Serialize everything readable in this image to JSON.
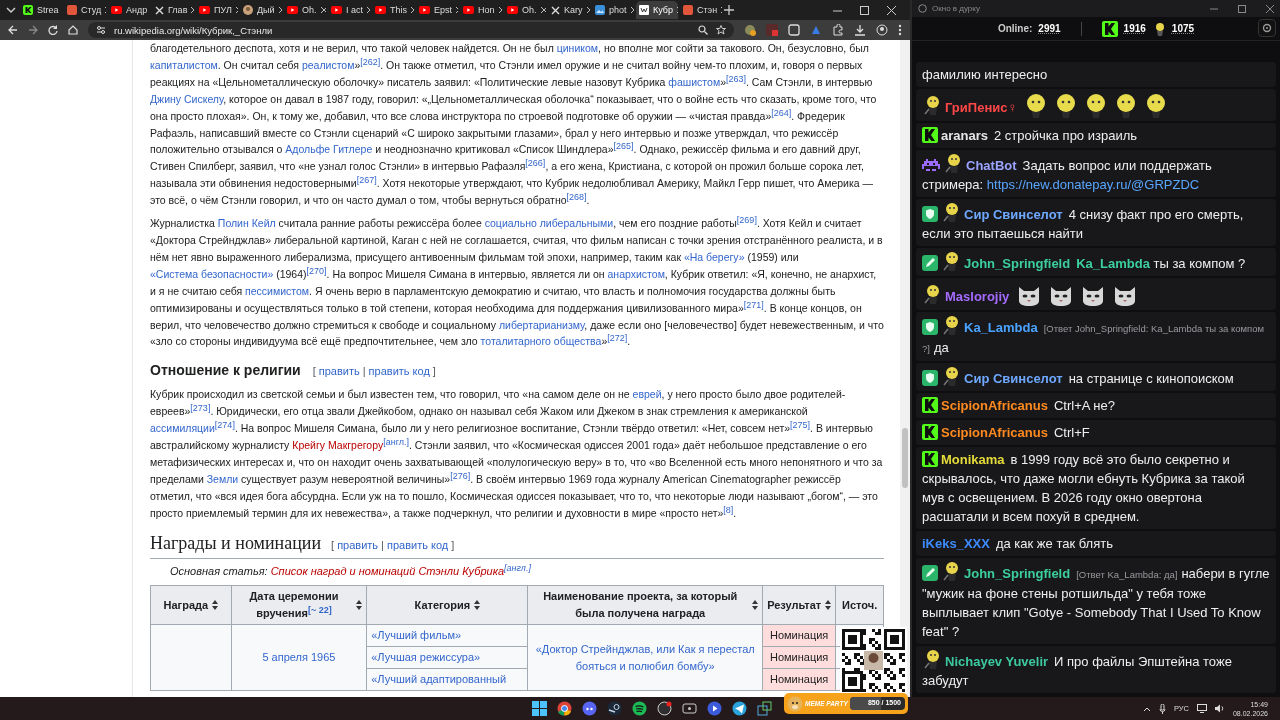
{
  "browser": {
    "tabs": [
      {
        "title": "Strea",
        "kind": "kick",
        "selected": false
      },
      {
        "title": "Студ",
        "kind": "site",
        "selected": false
      },
      {
        "title": "Андр",
        "kind": "youtube",
        "selected": false
      },
      {
        "title": "Глав",
        "kind": "x",
        "selected": false
      },
      {
        "title": "ПУЛ",
        "kind": "youtube",
        "selected": false
      },
      {
        "title": "Дый",
        "kind": "face",
        "selected": false
      },
      {
        "title": "Oh.",
        "kind": "youtube",
        "selected": false
      },
      {
        "title": "I act",
        "kind": "youtube",
        "selected": false
      },
      {
        "title": "This",
        "kind": "youtube",
        "selected": false
      },
      {
        "title": "Epst",
        "kind": "youtube",
        "selected": false
      },
      {
        "title": "Hon",
        "kind": "youtube",
        "selected": false
      },
      {
        "title": "Oh.",
        "kind": "youtube",
        "selected": false
      },
      {
        "title": "Kary",
        "kind": "x",
        "selected": false
      },
      {
        "title": "phot",
        "kind": "image",
        "selected": false
      },
      {
        "title": "Кубр",
        "kind": "wiki",
        "selected": true
      },
      {
        "title": "Стэн",
        "kind": "site",
        "selected": false
      }
    ],
    "address": "ru.wikipedia.org/wiki/Кубрик,_Стэнли"
  },
  "article": {
    "edit_brackets": {
      "open": "[",
      "separator": "|",
      "close": "]"
    },
    "blocks": [
      {
        "kind": "paragraph",
        "segments": [
          {
            "kind": "plain",
            "text": "благодетельного деспота, хотя и не верил, что такой человек найдется. Он не был "
          },
          {
            "kind": "link",
            "text": "циником"
          },
          {
            "kind": "plain",
            "text": ", но вполне мог сойти за такового. Он, безусловно, был "
          },
          {
            "kind": "link",
            "text": "капиталистом"
          },
          {
            "kind": "plain",
            "text": ". Он считал себя "
          },
          {
            "kind": "link",
            "text": "реалистом"
          },
          {
            "kind": "plain",
            "text": "»"
          },
          {
            "kind": "ref",
            "text": "[262]"
          },
          {
            "kind": "plain",
            "text": ". Он также отметил, что Стэнли имел оружие и не считал войну чем-то плохим, и, говоря о первых реакциях на «Цельнометаллическую оболочку» писатель заявил: «Политические левые назовут Кубрика "
          },
          {
            "kind": "link",
            "text": "фашистом"
          },
          {
            "kind": "plain",
            "text": "»"
          },
          {
            "kind": "ref",
            "text": "[263]"
          },
          {
            "kind": "plain",
            "text": ". Сам Стэнли, в интервью "
          },
          {
            "kind": "link",
            "text": "Джину Сискелу"
          },
          {
            "kind": "plain",
            "text": ", которое он давал в 1987 году, говорил: «„Цельнометаллическая оболочка“ показывает, что о войне есть что сказать, кроме того, что она просто плохая». Он, к тому же, добавил, что все слова инструктора по строевой подготовке об оружии — «чистая правда»"
          },
          {
            "kind": "ref",
            "text": "[264]"
          },
          {
            "kind": "plain",
            "text": ". Фредерик Рафаэль, написавший вместе со Стэнли сценарий «С широко закрытыми глазами», брал у него интервью и позже утверждал, что режиссёр положительно отзывался о "
          },
          {
            "kind": "link",
            "text": "Адольфе Гитлере"
          },
          {
            "kind": "plain",
            "text": " и неоднозначно критиковал «Список Шиндлера»"
          },
          {
            "kind": "ref",
            "text": "[265]"
          },
          {
            "kind": "plain",
            "text": ". Однако, режиссёр фильма и его давний друг, Стивен Спилберг, заявил, что «не узнал голос Стэнли» в интервью Рафаэля"
          },
          {
            "kind": "ref",
            "text": "[266]"
          },
          {
            "kind": "plain",
            "text": ", а его жена, Кристиана, с которой он прожил больше сорока лет, называла эти обвинения недостоверными"
          },
          {
            "kind": "ref",
            "text": "[267]"
          },
          {
            "kind": "plain",
            "text": ". Хотя некоторые утверждают, что Кубрик недолюбливал Америку, Майкл Герр пишет, что Америка — это всё, о чём Стэнли говорил, и что он часто думал о том, чтобы вернуться обратно"
          },
          {
            "kind": "ref",
            "text": "[268]"
          },
          {
            "kind": "plain",
            "text": "."
          }
        ]
      },
      {
        "kind": "paragraph",
        "segments": [
          {
            "kind": "plain",
            "text": "Журналистка "
          },
          {
            "kind": "link",
            "text": "Полин Кейл"
          },
          {
            "kind": "plain",
            "text": " считала ранние работы режиссёра более "
          },
          {
            "kind": "link",
            "text": "социально либеральными"
          },
          {
            "kind": "plain",
            "text": ", чем его поздние работы"
          },
          {
            "kind": "ref",
            "text": "[269]"
          },
          {
            "kind": "plain",
            "text": ". Хотя Кейл и считает «Доктора Стрейнджлав» либеральной картиной, Каган с ней не соглашается, считая, что фильм написан с точки зрения отстранённого реалиста, и в нём нет явно выраженного либерализма, присущего антивоенным фильмам той эпохи, например, таким как "
          },
          {
            "kind": "link",
            "text": "«На берегу»"
          },
          {
            "kind": "plain",
            "text": " (1959) или "
          },
          {
            "kind": "link",
            "text": "«Система безопасности»"
          },
          {
            "kind": "plain",
            "text": " (1964)"
          },
          {
            "kind": "ref",
            "text": "[270]"
          },
          {
            "kind": "plain",
            "text": ". На вопрос Мишеля Симана в интервью, является ли он "
          },
          {
            "kind": "link",
            "text": "анархистом"
          },
          {
            "kind": "plain",
            "text": ", Кубрик ответил: «Я, конечно, не анархист, и я не считаю себя "
          },
          {
            "kind": "link",
            "text": "пессимистом"
          },
          {
            "kind": "plain",
            "text": ". Я очень верю в парламентскую демократию и считаю, что власть и полномочия государства должны быть оптимизированы и осуществляться только в той степени, которая необходима для поддержания цивилизованного мира»"
          },
          {
            "kind": "ref",
            "text": "[271]"
          },
          {
            "kind": "plain",
            "text": ". В конце концов, он верил, что человечество должно стремиться к свободе и социальному "
          },
          {
            "kind": "link",
            "text": "либертарианизму"
          },
          {
            "kind": "plain",
            "text": ", даже если оно [человечество] будет невежественным, и что «зло со стороны индивидуума всё ещё предпочтительнее, чем зло "
          },
          {
            "kind": "link",
            "text": "тоталитарного общества"
          },
          {
            "kind": "plain",
            "text": "»"
          },
          {
            "kind": "ref",
            "text": "[272]"
          },
          {
            "kind": "plain",
            "text": "."
          }
        ]
      },
      {
        "kind": "subheading",
        "text": "Отношение к религии",
        "edit_links": [
          "править",
          "править код"
        ]
      },
      {
        "kind": "paragraph",
        "segments": [
          {
            "kind": "plain",
            "text": "Кубрик происходил из светской семьи и был известен тем, что говорил, что «на самом деле он не "
          },
          {
            "kind": "link",
            "text": "еврей"
          },
          {
            "kind": "plain",
            "text": ", у него просто было двое родителей-евреев»"
          },
          {
            "kind": "ref",
            "text": "[273]"
          },
          {
            "kind": "plain",
            "text": ". Юридически, его отца звали Джейкобом, однако он называл себя Жаком или Джеком в знак стремления к американской "
          },
          {
            "kind": "link",
            "text": "ассимиляции"
          },
          {
            "kind": "ref",
            "text": "[274]"
          },
          {
            "kind": "plain",
            "text": ". На вопрос Мишеля Симана, было ли у него религиозное воспитание, Стэнли твёрдо ответил: «Нет, совсем нет»"
          },
          {
            "kind": "ref",
            "text": "[275]"
          },
          {
            "kind": "plain",
            "text": ". В интервью австралийскому журналисту "
          },
          {
            "kind": "redlink",
            "text": "Крейгу Макгрегору"
          },
          {
            "kind": "ref",
            "text": "[англ.]"
          },
          {
            "kind": "plain",
            "text": ". Стэнли заявил, что «Космическая одиссея 2001 года» даёт небольшое представление о его метафизических интересах и, что он находит очень захватывающей «полулогическую веру» в то, что «во Вселенной есть много непонятного и что за пределами "
          },
          {
            "kind": "link",
            "text": "Земли"
          },
          {
            "kind": "plain",
            "text": " существует разум невероятной величины»"
          },
          {
            "kind": "ref",
            "text": "[276]"
          },
          {
            "kind": "plain",
            "text": ". В своём интервью 1969 года журналу American Cinematographer режиссёр отметил, что «вся идея бога абсурдна. Если уж на то пошло, Космическая одиссея показывает, что то, что некоторые люди называют „богом“, — это просто приемлемый термин для их невежества», а также подчеркнул, что религии и духовности в мире «просто нет»"
          },
          {
            "kind": "ref",
            "text": "[8]"
          },
          {
            "kind": "plain",
            "text": "."
          }
        ]
      },
      {
        "kind": "heading",
        "text": "Награды и номинации",
        "edit_links": [
          "править",
          "править код"
        ]
      },
      {
        "kind": "hatnote",
        "label": "Основная статья: ",
        "link": "Список наград и номинаций Стэнли Кубрика",
        "ref": "[англ.]"
      }
    ],
    "table": {
      "columns": [
        {
          "label": "Награда",
          "sortable": true
        },
        {
          "label": "Дата церемонии вручения",
          "ref": "[~ 22]",
          "sortable": true
        },
        {
          "label": "Категория",
          "sortable": true
        },
        {
          "label": "Наименование проекта, за который была получена награда",
          "sortable": true
        },
        {
          "label": "Результат",
          "sortable": true
        },
        {
          "label": "Источ.",
          "sortable": false
        }
      ],
      "rows": [
        {
          "date": "5 апреля 1965",
          "project": "«Доктор Стрейнджлав, или Как я перестал бояться и полюбил бомбу»",
          "entries": [
            {
              "category": "«Лучший фильм»",
              "result": "Номинация"
            },
            {
              "category": "«Лучшая режиссура»",
              "result": "Номинация"
            },
            {
              "category": "«Лучший адаптированный",
              "result": "Номинация"
            }
          ]
        }
      ]
    }
  },
  "chat": {
    "window_title": "Окно в дурку",
    "online_label": "Online:",
    "online": "2991",
    "kick_count": "1916",
    "avatar_count": "1075",
    "messages": [
      {
        "kind": "continuation",
        "parts": [
          {
            "kind": "plain",
            "text": "фамилию интересно"
          }
        ]
      },
      {
        "kind": "emotes",
        "user": "ГриПенис♀",
        "color": "#ff4747",
        "badges": [
          {
            "kind": "avatar"
          }
        ],
        "emotes": [
          {
            "kind": "head"
          },
          {
            "kind": "head"
          },
          {
            "kind": "head"
          },
          {
            "kind": "head"
          },
          {
            "kind": "head"
          }
        ]
      },
      {
        "kind": "text",
        "user": "aranars",
        "color": "#e6e6e6",
        "badges": [
          {
            "kind": "kick"
          }
        ],
        "parts": [
          {
            "kind": "plain",
            "text": "2 стройчка про израиль"
          }
        ]
      },
      {
        "kind": "text",
        "user": "ChatBot",
        "color": "#9aa4ff",
        "badges": [
          {
            "kind": "bot"
          },
          {
            "kind": "avatar"
          }
        ],
        "parts": [
          {
            "kind": "plain",
            "text": "Задать вопрос или поддержать стримера: "
          },
          {
            "kind": "link",
            "text": "https://new.donatepay.ru/@GRPZDC"
          }
        ]
      },
      {
        "kind": "text",
        "user": "Сир Свинселот",
        "color": "#6ea8ff",
        "badges": [
          {
            "kind": "shield"
          },
          {
            "kind": "avatar"
          }
        ],
        "parts": [
          {
            "kind": "plain",
            "text": "4 снизу факт про его смерть, если это пытаешься найти"
          }
        ]
      },
      {
        "kind": "text",
        "user": "John_Springfield",
        "color": "#3ccf9c",
        "badges": [
          {
            "kind": "pencil"
          },
          {
            "kind": "avatar"
          }
        ],
        "parts": [
          {
            "kind": "mention",
            "text": "Ka_Lambda"
          },
          {
            "kind": "plain",
            "text": " ты за компом ?"
          }
        ]
      },
      {
        "kind": "emotes",
        "user": "Maslorojiy",
        "color": "#a56bff",
        "badges": [
          {
            "kind": "avatar"
          }
        ],
        "emotes": [
          {
            "kind": "cat"
          },
          {
            "kind": "cat"
          },
          {
            "kind": "cat"
          },
          {
            "kind": "cat"
          }
        ]
      },
      {
        "kind": "text",
        "user": "Ka_Lambda",
        "color": "#4aa3ff",
        "badges": [
          {
            "kind": "shield"
          },
          {
            "kind": "avatar"
          }
        ],
        "reply": "[Ответ John_Springfield: Ka_Lambda ты за компом ?]",
        "parts": [
          {
            "kind": "plain",
            "text": "да"
          }
        ]
      },
      {
        "kind": "text",
        "user": "Сир Свинселот",
        "color": "#6ea8ff",
        "badges": [
          {
            "kind": "shield"
          },
          {
            "kind": "avatar"
          }
        ],
        "parts": [
          {
            "kind": "plain",
            "text": "на странице с кинопоиском"
          }
        ]
      },
      {
        "kind": "text",
        "user": "ScipionAfricanus",
        "color": "#ff8a1e",
        "badges": [
          {
            "kind": "kick"
          }
        ],
        "parts": [
          {
            "kind": "plain",
            "text": "Ctrl+A не?"
          }
        ]
      },
      {
        "kind": "text",
        "user": "ScipionAfricanus",
        "color": "#ff8a1e",
        "badges": [
          {
            "kind": "kick"
          }
        ],
        "parts": [
          {
            "kind": "plain",
            "text": "Ctrl+F"
          }
        ]
      },
      {
        "kind": "text",
        "user": "Monikama",
        "color": "#e6dc3a",
        "badges": [
          {
            "kind": "kick"
          }
        ],
        "parts": [
          {
            "kind": "plain",
            "text": "в 1999 году всё это было секретно и скрывалось, что даже могли ебнуть Кубрика за такой мув с освещением. В 2026 году окно овертона расшатали и всем похуй в среднем."
          }
        ]
      },
      {
        "kind": "text",
        "user": "iKeks_XXX",
        "color": "#3d8bff",
        "parts": [
          {
            "kind": "plain",
            "text": "да как же так блять"
          }
        ]
      },
      {
        "kind": "text",
        "user": "John_Springfield",
        "color": "#3ccf9c",
        "badges": [
          {
            "kind": "pencil"
          },
          {
            "kind": "avatar"
          }
        ],
        "reply": "[Ответ Ka_Lambda: да]",
        "parts": [
          {
            "kind": "plain",
            "text": "набери в гугле \"мужик на фоне стены ротшильда\" у тебя тоже выплывает клип \"Gotye - Somebody That I Used To Know feat\" ?"
          }
        ]
      },
      {
        "kind": "text",
        "user": "Nichayev Yuvelir",
        "color": "#3cc99e",
        "badges": [
          {
            "kind": "avatar"
          }
        ],
        "parts": [
          {
            "kind": "plain",
            "text": "И про файлы Эпштейна тоже забудут"
          }
        ]
      }
    ]
  },
  "meme_party": {
    "title": "MEME PARTY",
    "progress": "850 / 1500",
    "level": 0.57
  },
  "taskbar": {
    "language": "РУС",
    "time": "15:49",
    "date": "08.02.2026"
  }
}
